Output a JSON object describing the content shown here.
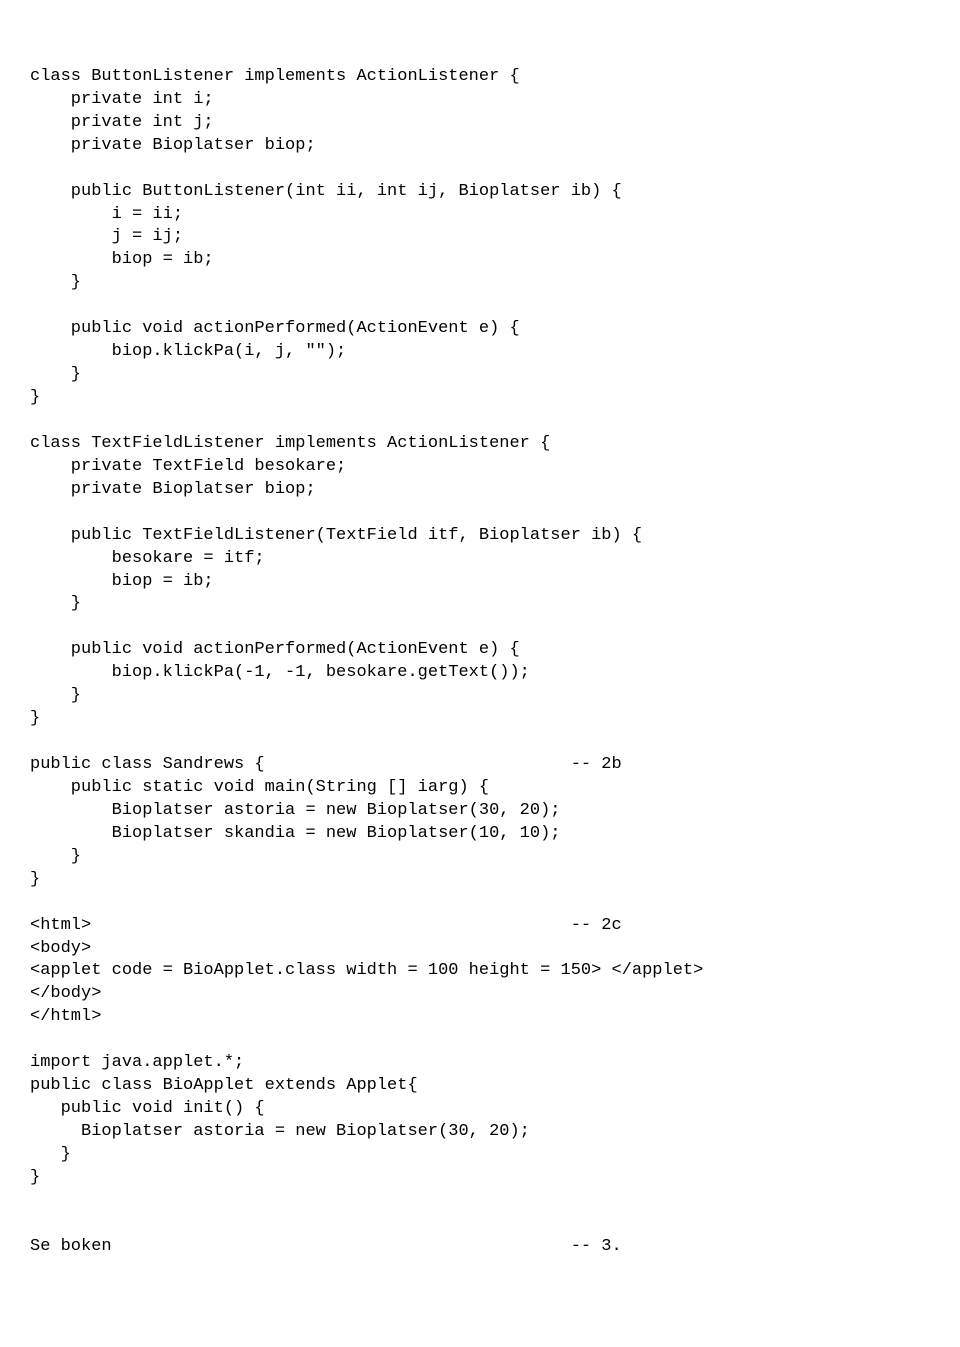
{
  "code": "class ButtonListener implements ActionListener {\n    private int i;\n    private int j;\n    private Bioplatser biop;\n\n    public ButtonListener(int ii, int ij, Bioplatser ib) {\n        i = ii;\n        j = ij;\n        biop = ib;\n    }\n\n    public void actionPerformed(ActionEvent e) {\n        biop.klickPa(i, j, \"\");\n    }\n}\n\nclass TextFieldListener implements ActionListener {\n    private TextField besokare;\n    private Bioplatser biop;\n\n    public TextFieldListener(TextField itf, Bioplatser ib) {\n        besokare = itf;\n        biop = ib;\n    }\n\n    public void actionPerformed(ActionEvent e) {\n        biop.klickPa(-1, -1, besokare.getText());\n    }\n}\n\npublic class Sandrews {                              -- 2b\n    public static void main(String [] iarg) {\n        Bioplatser astoria = new Bioplatser(30, 20);\n        Bioplatser skandia = new Bioplatser(10, 10);\n    }\n}\n\n<html>                                               -- 2c\n<body>\n<applet code = BioApplet.class width = 100 height = 150> </applet>\n</body>\n</html>\n\nimport java.applet.*;\npublic class BioApplet extends Applet{\n   public void init() {\n     Bioplatser astoria = new Bioplatser(30, 20);\n   }\n}\n\n\nSe boken                                             -- 3."
}
